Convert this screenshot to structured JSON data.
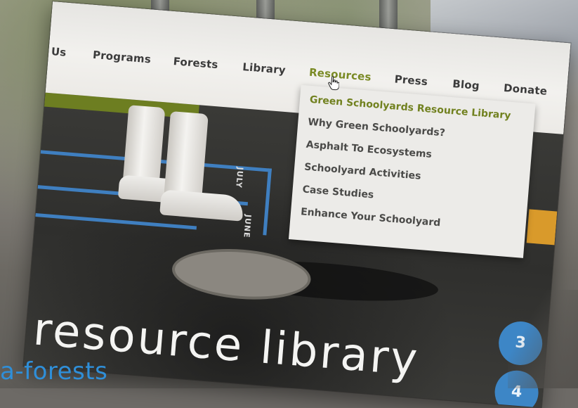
{
  "nav": {
    "items": [
      {
        "label": "ut Us"
      },
      {
        "label": "Programs"
      },
      {
        "label": "Forests"
      },
      {
        "label": "Library"
      },
      {
        "label": "Resources"
      },
      {
        "label": "Press"
      },
      {
        "label": "Blog"
      },
      {
        "label": "Donate"
      }
    ],
    "active_index": 4,
    "active_color": "#7a8a25"
  },
  "dropdown": {
    "items": [
      {
        "label": "Green Schoolyards Resource Library"
      },
      {
        "label": "Why Green Schoolyards?"
      },
      {
        "label": "Asphalt To Ecosystems"
      },
      {
        "label": "Schoolyard Activities"
      },
      {
        "label": "Case Studies"
      },
      {
        "label": "Enhance Your Schoolyard"
      }
    ],
    "highlight_index": 0,
    "highlight_color": "#71811f"
  },
  "hero": {
    "title": "resource library",
    "court_text_1": "JULY",
    "court_text_2": "JUNE",
    "circle_1": "3",
    "circle_2": "4"
  },
  "url_fragment": "a-forests",
  "icons": {
    "cursor": "hand-pointer-icon"
  }
}
